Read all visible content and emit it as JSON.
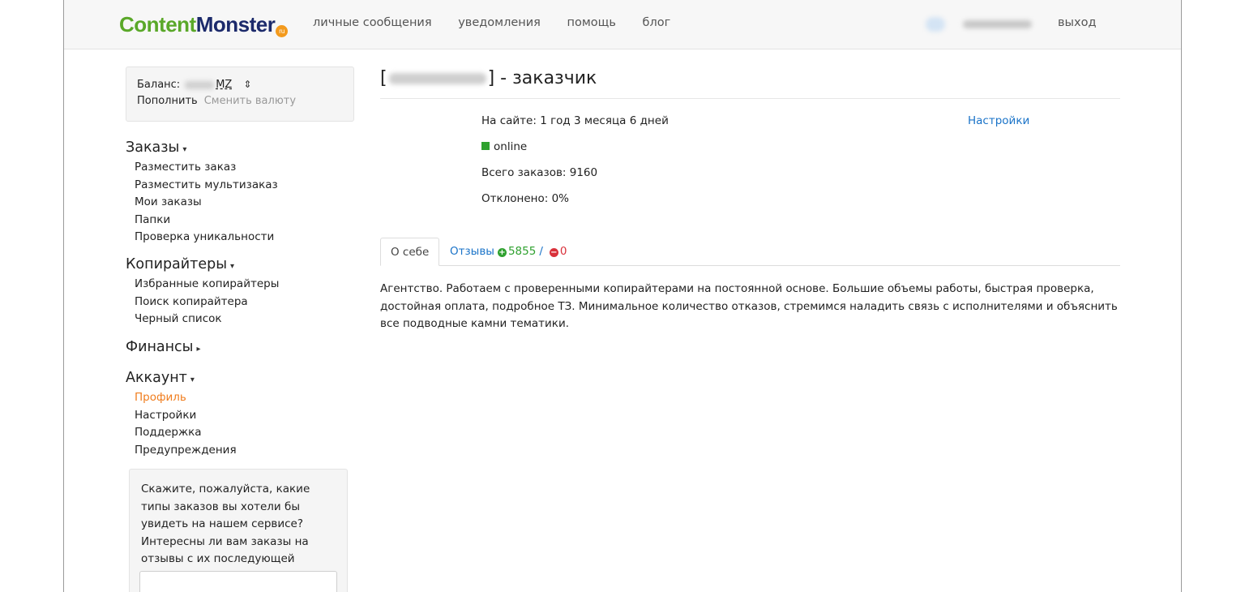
{
  "header": {
    "logo": {
      "part1": "Content",
      "part2": "Monster",
      "badge": "ru"
    },
    "nav": [
      "личные сообщения",
      "уведомления",
      "помощь",
      "блог"
    ],
    "logout": "выход"
  },
  "balance": {
    "label": "Баланс:",
    "currency": "MZ",
    "swap_icon": "swap-icon",
    "topup": "Пополнить",
    "change_currency": "Сменить валюту"
  },
  "sidebar": {
    "orders": {
      "title": "Заказы",
      "items": [
        "Разместить заказ",
        "Разместить мультизаказ",
        "Мои заказы",
        "Папки",
        "Проверка уникальности"
      ]
    },
    "copywriters": {
      "title": "Копирайтеры",
      "items": [
        "Избранные копирайтеры",
        "Поиск копирайтера",
        "Черный список"
      ]
    },
    "finance": {
      "title": "Финансы"
    },
    "account": {
      "title": "Аккаунт",
      "items": [
        "Профиль",
        "Настройки",
        "Поддержка",
        "Предупреждения"
      ],
      "active_index": 0
    },
    "survey": {
      "text": "Скажите, пожалуйста, какие типы заказов вы хотели бы увидеть на нашем сервисе? Интересны ли вам заказы на отзывы с их последующей публикацией?"
    }
  },
  "profile": {
    "title_open": "[",
    "title_close": "] - заказчик",
    "on_site": "На сайте: 1 год 3 месяца 6 дней",
    "status": "online",
    "total_orders": "Всего заказов: 9160",
    "rejected": "Отклонено: 0%",
    "settings_link": "Настройки",
    "status_color": "#2fa12f"
  },
  "tabs": {
    "about": "О себе",
    "reviews": "Отзывы",
    "positive": "5855",
    "separator": "/",
    "negative": "0"
  },
  "about_text": "Агентство. Работаем с проверенными копирайтерами на постоянной основе. Большие объемы работы, быстрая проверка, достойная оплата, подробное ТЗ. Минимальное количество отказов, стремимся наладить связь с исполнителями и объяснить все подводные камни тематики.",
  "colors": {
    "accent": "#1a73c8",
    "active": "#f07d1e",
    "positive": "#2fa12f",
    "negative": "#d9303a",
    "logo_green": "#5aa829",
    "logo_navy": "#1c2a6b"
  }
}
